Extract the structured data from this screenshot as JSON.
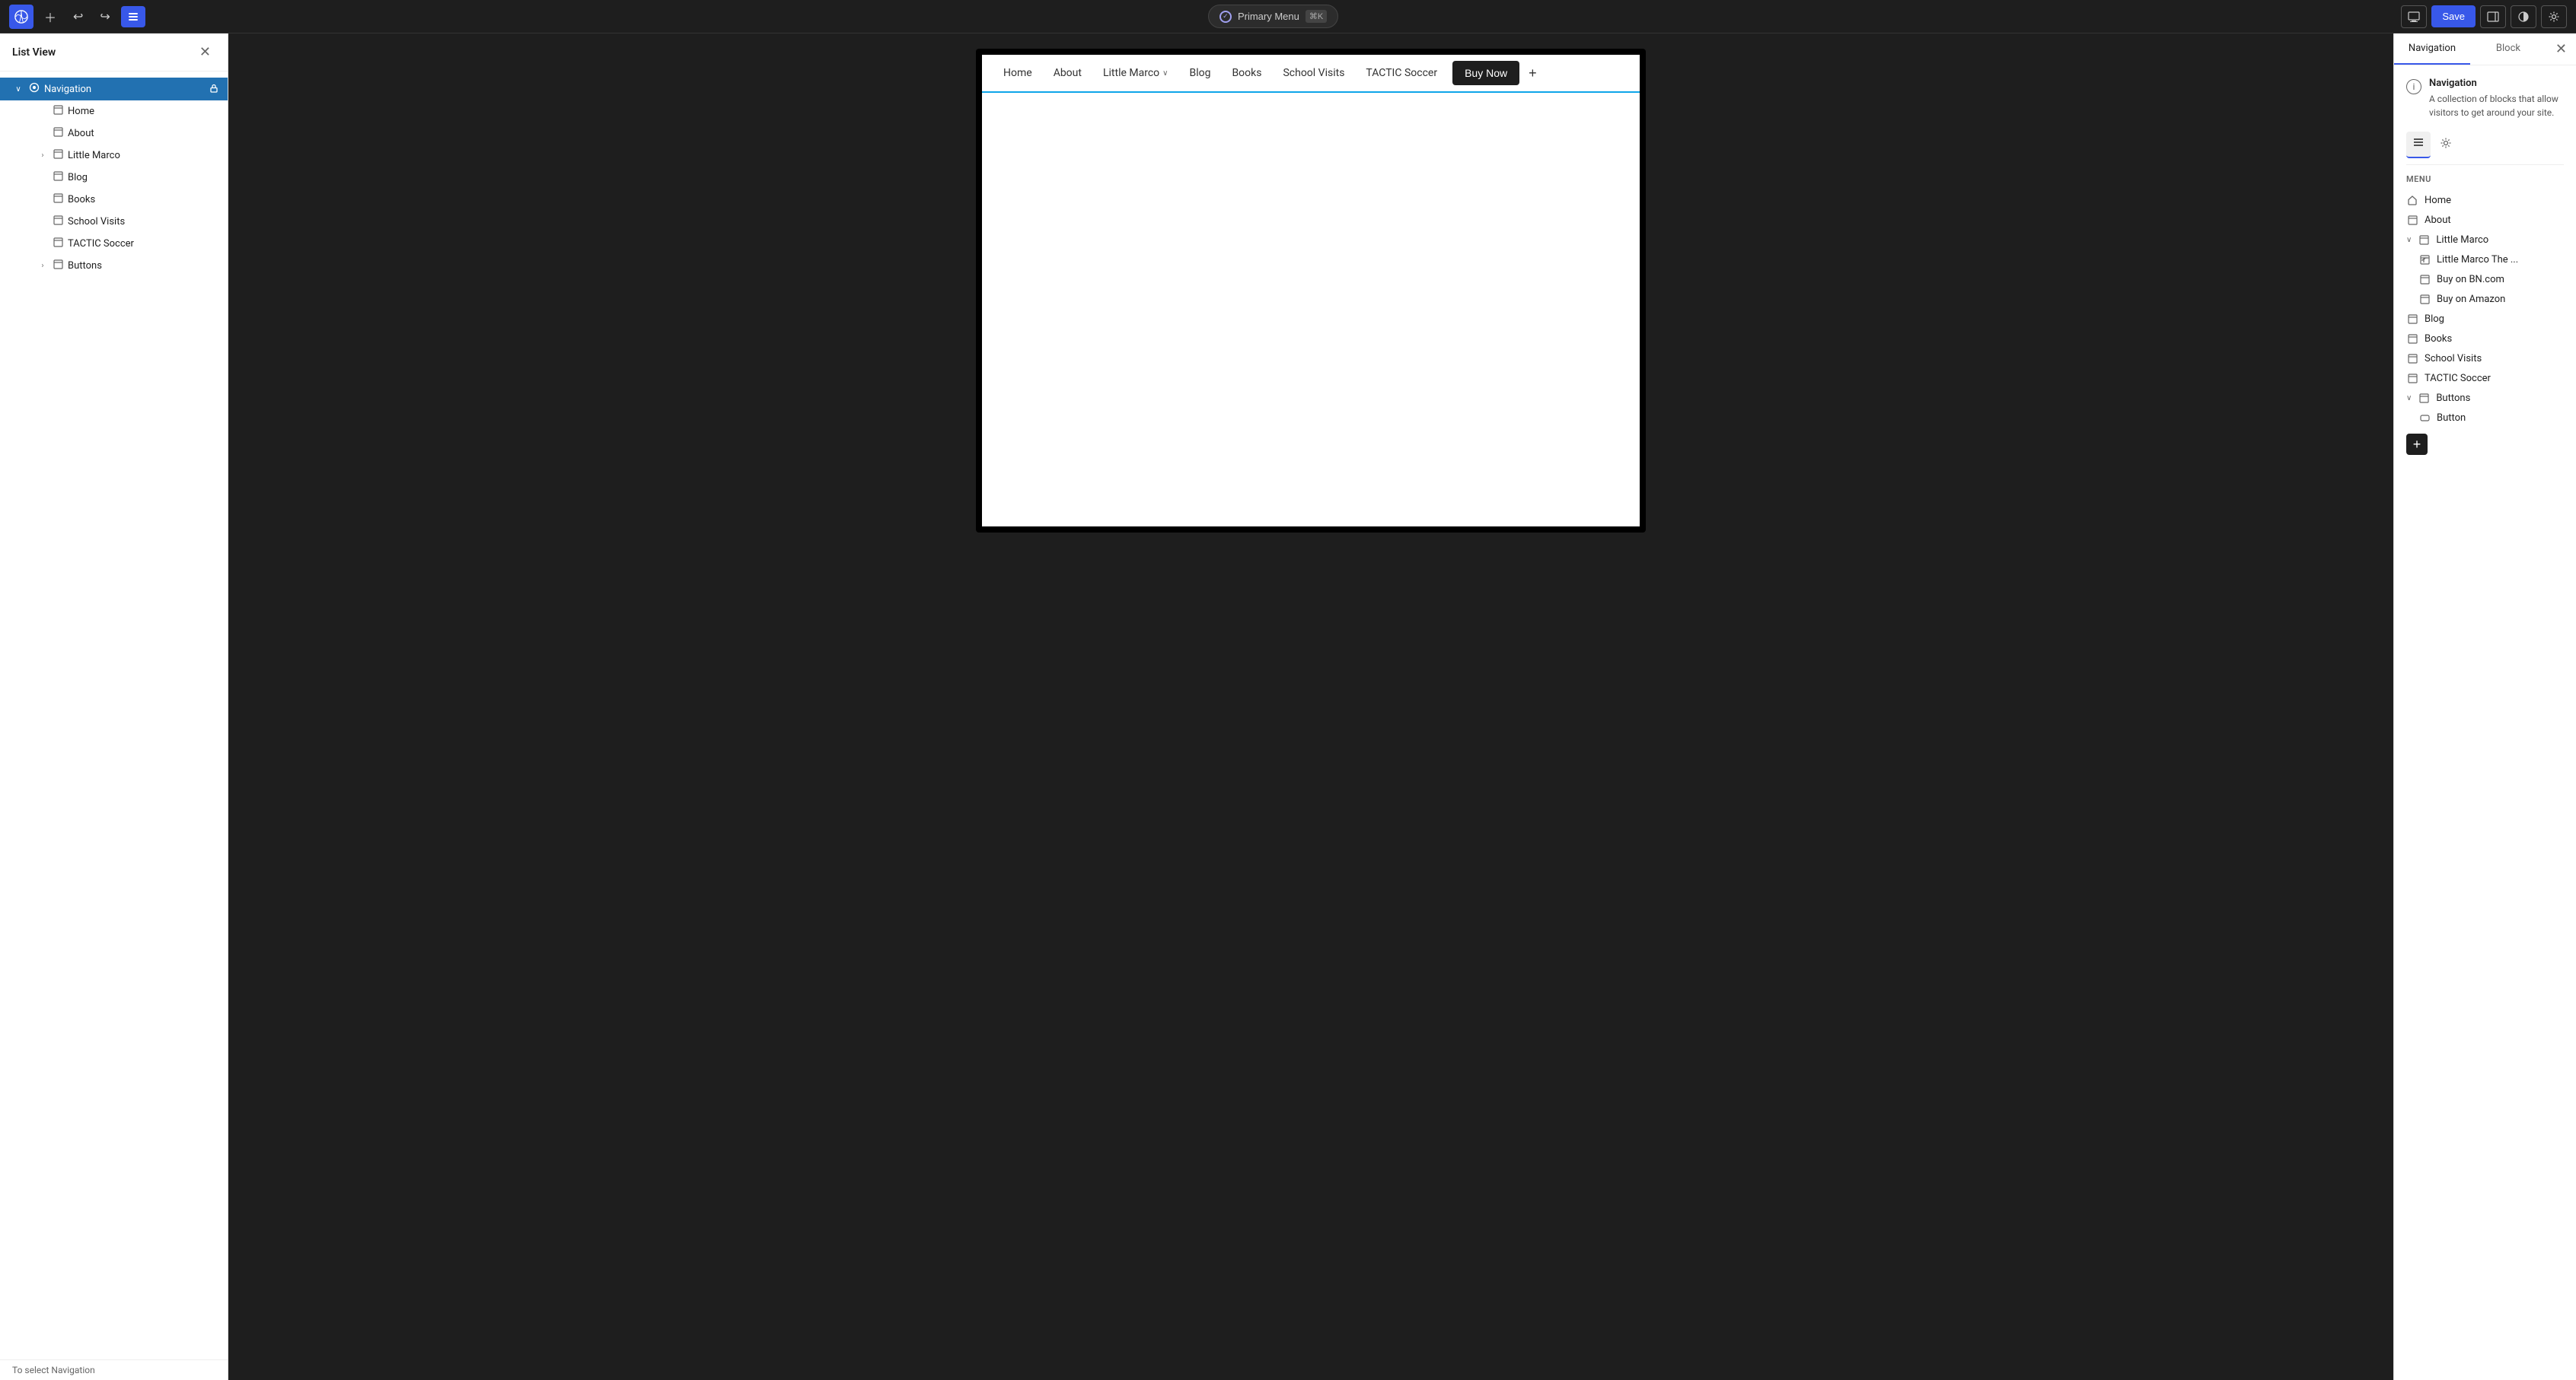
{
  "toolbar": {
    "wp_logo": "W",
    "undo_label": "↩",
    "redo_label": "↪",
    "list_view_label": "☰",
    "primary_menu_label": "Primary Menu",
    "primary_menu_shortcut": "⌘K",
    "save_label": "Save",
    "desktop_icon": "□",
    "sidebar_icon": "▤",
    "contrast_icon": "◑",
    "settings_icon": "⚙"
  },
  "left_panel": {
    "title": "List View",
    "close_label": "✕",
    "tree": [
      {
        "id": "navigation",
        "label": "Navigation",
        "level": 0,
        "expandable": true,
        "expanded": true,
        "active": true,
        "has_lock": true,
        "icon": "◎"
      },
      {
        "id": "home",
        "label": "Home",
        "level": 1,
        "expandable": false,
        "icon": "□"
      },
      {
        "id": "about",
        "label": "About",
        "level": 1,
        "expandable": false,
        "icon": "□"
      },
      {
        "id": "little-marco",
        "label": "Little Marco",
        "level": 1,
        "expandable": true,
        "expanded": false,
        "icon": "□"
      },
      {
        "id": "blog",
        "label": "Blog",
        "level": 1,
        "expandable": false,
        "icon": "□"
      },
      {
        "id": "books",
        "label": "Books",
        "level": 1,
        "expandable": false,
        "icon": "□"
      },
      {
        "id": "school-visits",
        "label": "School Visits",
        "level": 1,
        "expandable": false,
        "icon": "□"
      },
      {
        "id": "tactic-soccer",
        "label": "TACTIC Soccer",
        "level": 1,
        "expandable": false,
        "icon": "□"
      },
      {
        "id": "buttons",
        "label": "Buttons",
        "level": 1,
        "expandable": true,
        "expanded": false,
        "icon": "□"
      }
    ],
    "bottom_text": "To select Navigation"
  },
  "canvas": {
    "nav_items": [
      {
        "id": "home",
        "label": "Home",
        "has_dropdown": false
      },
      {
        "id": "about",
        "label": "About",
        "has_dropdown": false
      },
      {
        "id": "little-marco",
        "label": "Little Marco",
        "has_dropdown": true
      },
      {
        "id": "blog",
        "label": "Blog",
        "has_dropdown": false
      },
      {
        "id": "books",
        "label": "Books",
        "has_dropdown": false
      },
      {
        "id": "school-visits",
        "label": "School Visits",
        "has_dropdown": false
      },
      {
        "id": "tactic-soccer",
        "label": "TACTIC Soccer",
        "has_dropdown": false
      }
    ],
    "buy_now_label": "Buy Now",
    "add_item_label": "+"
  },
  "right_panel": {
    "tabs": [
      {
        "id": "navigation",
        "label": "Navigation",
        "active": true
      },
      {
        "id": "block",
        "label": "Block",
        "active": false
      }
    ],
    "close_label": "✕",
    "nav_title": "Navigation",
    "nav_description": "A collection of blocks that allow visitors to get around your site.",
    "settings_icon": "☰",
    "gear_icon": "⚙",
    "menu_label": "Menu",
    "menu_items": [
      {
        "id": "home",
        "label": "Home",
        "level": 0,
        "icon": "⌂",
        "expandable": false
      },
      {
        "id": "about",
        "label": "About",
        "level": 0,
        "icon": "□",
        "expandable": false
      },
      {
        "id": "little-marco",
        "label": "Little Marco",
        "level": 0,
        "icon": "□",
        "expandable": true,
        "expanded": true
      },
      {
        "id": "little-marco-the",
        "label": "Little Marco The ...",
        "level": 1,
        "icon": "↩",
        "expandable": false
      },
      {
        "id": "buy-on-bn",
        "label": "Buy on BN.com",
        "level": 1,
        "icon": "↩",
        "expandable": false
      },
      {
        "id": "buy-on-amazon",
        "label": "Buy on Amazon",
        "level": 1,
        "icon": "↩",
        "expandable": false
      },
      {
        "id": "blog",
        "label": "Blog",
        "level": 0,
        "icon": "□",
        "expandable": false
      },
      {
        "id": "books",
        "label": "Books",
        "level": 0,
        "icon": "□",
        "expandable": false
      },
      {
        "id": "school-visits",
        "label": "School Visits",
        "level": 0,
        "icon": "□",
        "expandable": false
      },
      {
        "id": "tactic-soccer",
        "label": "TACTIC Soccer",
        "level": 0,
        "icon": "□",
        "expandable": false
      },
      {
        "id": "buttons",
        "label": "Buttons",
        "level": 0,
        "icon": "□",
        "expandable": true,
        "expanded": true
      },
      {
        "id": "button",
        "label": "Button",
        "level": 1,
        "icon": "▭",
        "expandable": false
      }
    ],
    "add_label": "+"
  }
}
